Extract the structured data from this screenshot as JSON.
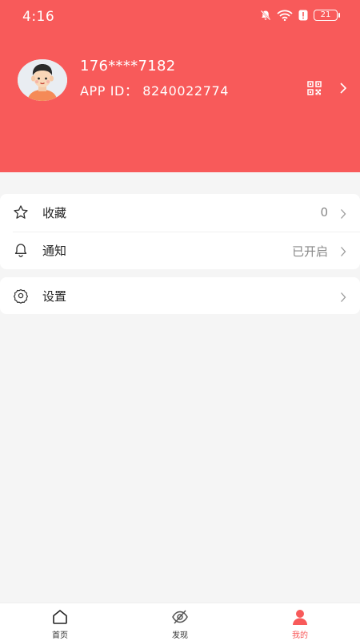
{
  "status_bar": {
    "time": "4:16",
    "battery": "21"
  },
  "profile": {
    "phone": "176****7182",
    "app_id": "APP ID：  8240022774"
  },
  "menu": [
    {
      "label": "收藏",
      "value": "0",
      "icon": "star-icon"
    },
    {
      "label": "通知",
      "value": "已开启",
      "icon": "bell-icon"
    },
    {
      "label": "设置",
      "value": "",
      "icon": "gear-icon"
    }
  ],
  "tabbar": {
    "items": [
      {
        "label": "首页",
        "icon": "home-icon"
      },
      {
        "label": "发现",
        "icon": "discover-icon"
      },
      {
        "label": "我的",
        "icon": "user-icon"
      }
    ],
    "active_index": 2
  },
  "colors": {
    "accent": "#f85a5a",
    "background": "#f5f5f5"
  }
}
